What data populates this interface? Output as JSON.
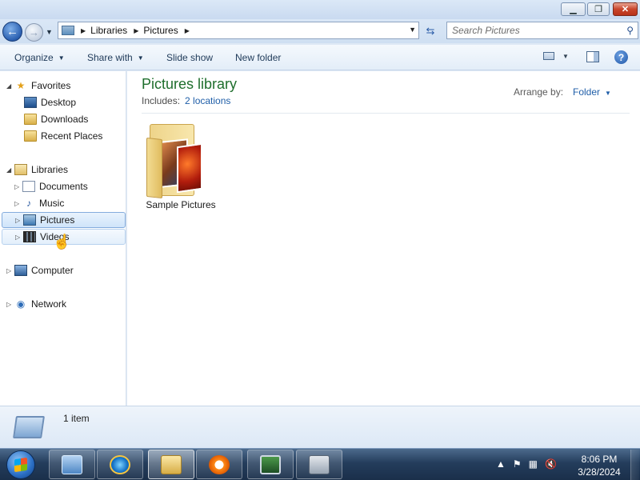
{
  "window": {
    "minimize_icon": "minimize-icon",
    "maximize_icon": "restore-icon",
    "close_icon": "close-icon"
  },
  "address": {
    "crumbs": [
      "Libraries",
      "Pictures"
    ],
    "search_placeholder": "Search Pictures"
  },
  "toolbar": {
    "organize": "Organize",
    "share_with": "Share with",
    "slide_show": "Slide show",
    "new_folder": "New folder"
  },
  "sidebar": {
    "favorites": "Favorites",
    "desktop": "Desktop",
    "downloads": "Downloads",
    "recent_places": "Recent Places",
    "libraries": "Libraries",
    "documents": "Documents",
    "music": "Music",
    "pictures": "Pictures",
    "videos": "Videos",
    "computer": "Computer",
    "network": "Network"
  },
  "main": {
    "library_title": "Pictures library",
    "includes_label": "Includes:",
    "includes_link": "2 locations",
    "arrange_label": "Arrange by:",
    "arrange_value": "Folder",
    "items": [
      {
        "name": "Sample Pictures",
        "icon": "photo-folder-icon"
      }
    ]
  },
  "details": {
    "count": "1 item"
  },
  "taskbar": {
    "time": "8:06 PM",
    "date": "3/28/2024",
    "apps": [
      "control-panel",
      "internet-explorer",
      "windows-explorer",
      "media-player",
      "task-manager",
      "archive-manager"
    ]
  },
  "colors": {
    "title_green": "#1e6e2c",
    "link_blue": "#1f5ea8",
    "selection_border": "#84acdd"
  }
}
